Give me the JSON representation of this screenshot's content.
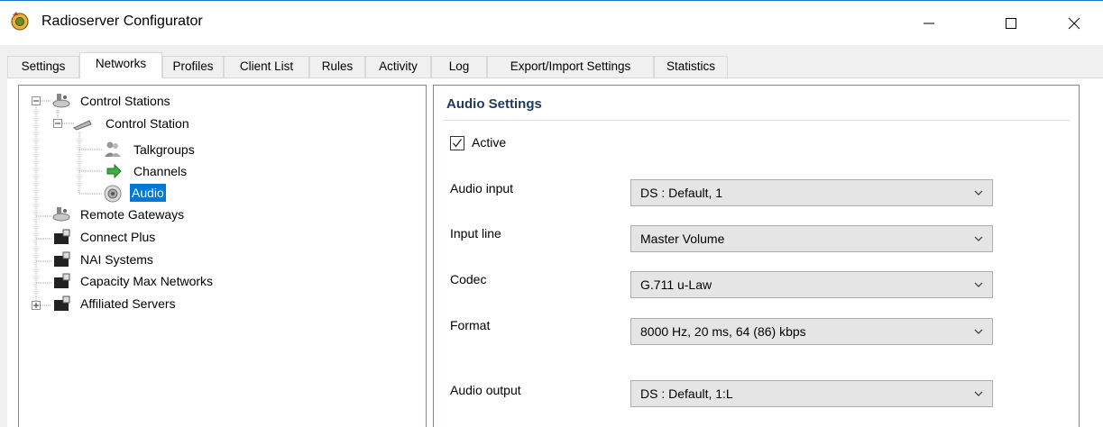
{
  "window": {
    "title": "Radioserver Configurator"
  },
  "tabs": [
    {
      "label": "Settings",
      "selected": false
    },
    {
      "label": "Networks",
      "selected": true
    },
    {
      "label": "Profiles",
      "selected": false
    },
    {
      "label": "Client List",
      "selected": false
    },
    {
      "label": "Rules",
      "selected": false
    },
    {
      "label": "Activity",
      "selected": false
    },
    {
      "label": "Log",
      "selected": false
    },
    {
      "label": "Export/Import Settings",
      "selected": false
    },
    {
      "label": "Statistics",
      "selected": false
    }
  ],
  "tree": {
    "nodes": [
      {
        "label": "Control Stations",
        "icon": "radio-icon",
        "expanded": true
      },
      {
        "label": "Control Station",
        "icon": "antenna-icon",
        "expanded": true
      },
      {
        "label": "Talkgroups",
        "icon": "users-icon"
      },
      {
        "label": "Channels",
        "icon": "green-arrow-icon"
      },
      {
        "label": "Audio",
        "icon": "speaker-icon",
        "selected": true
      },
      {
        "label": "Remote Gateways",
        "icon": "radio-icon"
      },
      {
        "label": "Connect Plus",
        "icon": "server-icon"
      },
      {
        "label": "NAI Systems",
        "icon": "server-icon"
      },
      {
        "label": "Capacity Max Networks",
        "icon": "server-icon"
      },
      {
        "label": "Affiliated Servers",
        "icon": "server-icon",
        "expandable": true
      }
    ]
  },
  "audio_settings": {
    "title": "Audio Settings",
    "active_label": "Active",
    "active_checked": true,
    "fields": [
      {
        "label": "Audio input",
        "value": "DS : Default, 1"
      },
      {
        "label": "Input line",
        "value": "Master Volume"
      },
      {
        "label": "Codec",
        "value": "G.711 u-Law"
      },
      {
        "label": "Format",
        "value": "8000 Hz, 20 ms, 64 (86) kbps"
      },
      {
        "label": "Audio output",
        "value": "DS : Default, 1:L"
      }
    ]
  }
}
